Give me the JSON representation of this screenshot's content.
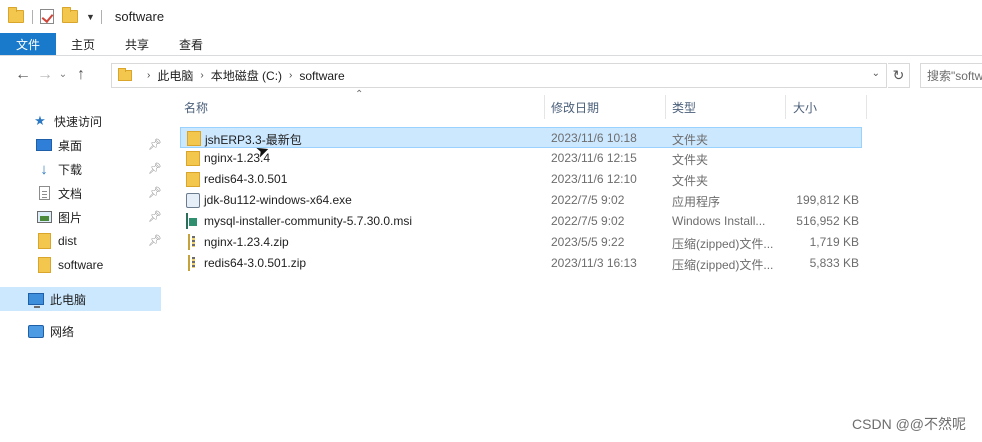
{
  "window": {
    "title": "software"
  },
  "ribbon": {
    "tabs": [
      "文件",
      "主页",
      "共享",
      "查看"
    ]
  },
  "address": {
    "crumbs": [
      "此电脑",
      "本地磁盘 (C:)",
      "software"
    ],
    "search_placeholder": "搜索\"software\""
  },
  "nav": {
    "quick_access": "快速访问",
    "items": [
      {
        "label": "桌面",
        "icon": "desktop-icon",
        "pinned": true
      },
      {
        "label": "下载",
        "icon": "download-icon",
        "pinned": true
      },
      {
        "label": "文档",
        "icon": "document-icon",
        "pinned": true
      },
      {
        "label": "图片",
        "icon": "pictures-icon",
        "pinned": true
      },
      {
        "label": "dist",
        "icon": "folder-icon",
        "pinned": true
      },
      {
        "label": "software",
        "icon": "folder-icon",
        "pinned": false
      }
    ],
    "this_pc": "此电脑",
    "network": "网络"
  },
  "columns": {
    "name": "名称",
    "date": "修改日期",
    "type": "类型",
    "size": "大小"
  },
  "files": [
    {
      "name": "jshERP3.3-最新包",
      "date": "2023/11/6 10:18",
      "type": "文件夹",
      "size": "",
      "icon": "folder-icon",
      "selected": true
    },
    {
      "name": "nginx-1.23.4",
      "date": "2023/11/6 12:15",
      "type": "文件夹",
      "size": "",
      "icon": "folder-icon",
      "selected": false
    },
    {
      "name": "redis64-3.0.501",
      "date": "2023/11/6 12:10",
      "type": "文件夹",
      "size": "",
      "icon": "folder-icon",
      "selected": false
    },
    {
      "name": "jdk-8u112-windows-x64.exe",
      "date": "2022/7/5 9:02",
      "type": "应用程序",
      "size": "199,812 KB",
      "icon": "exe-icon",
      "selected": false
    },
    {
      "name": "mysql-installer-community-5.7.30.0.msi",
      "date": "2022/7/5 9:02",
      "type": "Windows Install...",
      "size": "516,952 KB",
      "icon": "msi-icon",
      "selected": false
    },
    {
      "name": "nginx-1.23.4.zip",
      "date": "2023/5/5 9:22",
      "type": "压缩(zipped)文件...",
      "size": "1,719 KB",
      "icon": "zip-icon",
      "selected": false
    },
    {
      "name": "redis64-3.0.501.zip",
      "date": "2023/11/3 16:13",
      "type": "压缩(zipped)文件...",
      "size": "5,833 KB",
      "icon": "zip-icon",
      "selected": false
    }
  ],
  "watermark": "CSDN @@不然呢"
}
